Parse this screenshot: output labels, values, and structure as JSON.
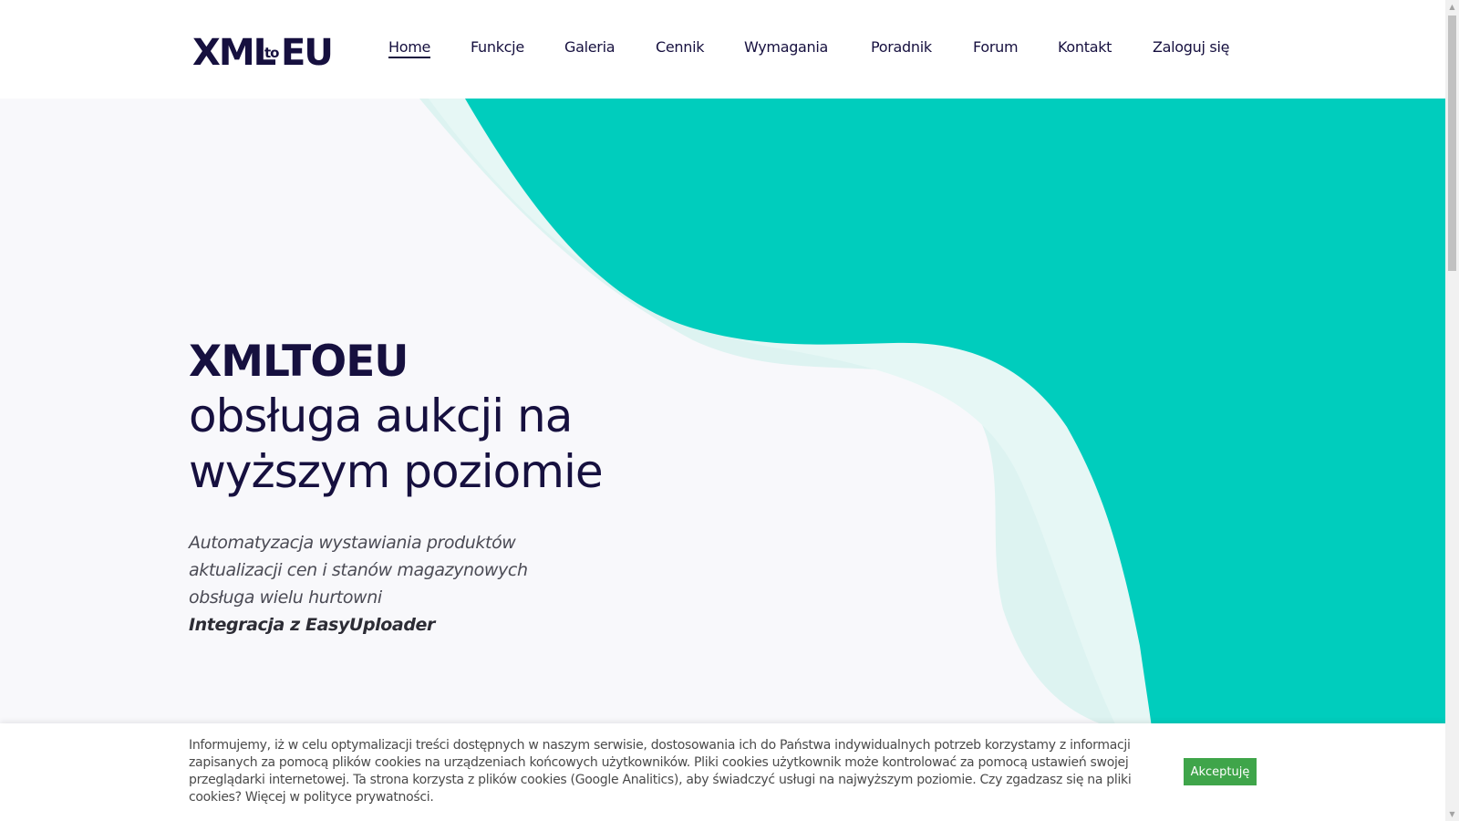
{
  "logo": {
    "part1": "XML",
    "part2": "to",
    "part3": "EU"
  },
  "nav": {
    "items": [
      {
        "label": "Home",
        "active": true
      },
      {
        "label": "Funkcje"
      },
      {
        "label": "Galeria"
      },
      {
        "label": "Cennik"
      },
      {
        "label": "Wymagania"
      },
      {
        "label": "Poradnik"
      },
      {
        "label": "Forum"
      },
      {
        "label": "Kontakt"
      },
      {
        "label": "Zaloguj się"
      }
    ]
  },
  "hero": {
    "title": "XMLTOEU",
    "subtitle_line1": "obsługa aukcji na",
    "subtitle_line2": "wyższym poziomie",
    "desc_line1": "Automatyzacja wystawiania produktów",
    "desc_line2": "aktualizacji cen i stanów magazynowych",
    "desc_line3": "obsługa wielu hurtowni",
    "desc_line4": "Integracja z EasyUploader"
  },
  "cookie": {
    "text": "Informujemy, iż w celu optymalizacji treści dostępnych w naszym serwisie, dostosowania ich do Państwa indywidualnych potrzeb korzystamy z informacji zapisanych za pomocą plików cookies na urządzeniach końcowych użytkowników. Pliki cookies użytkownik może kontrolować za pomocą ustawień swojej przeglądarki internetowej. Ta strona korzysta z plików cookies (Google Analitics), aby świadczyć usługi na najwyższym poziomie. Czy zgadzasz się na pliki cookies? Więcej w polityce prywatności.",
    "accept_label": "Akceptuję"
  },
  "colors": {
    "accent": "#00cdbd",
    "dark": "#16103f",
    "cookie_button": "#3fa54a"
  }
}
